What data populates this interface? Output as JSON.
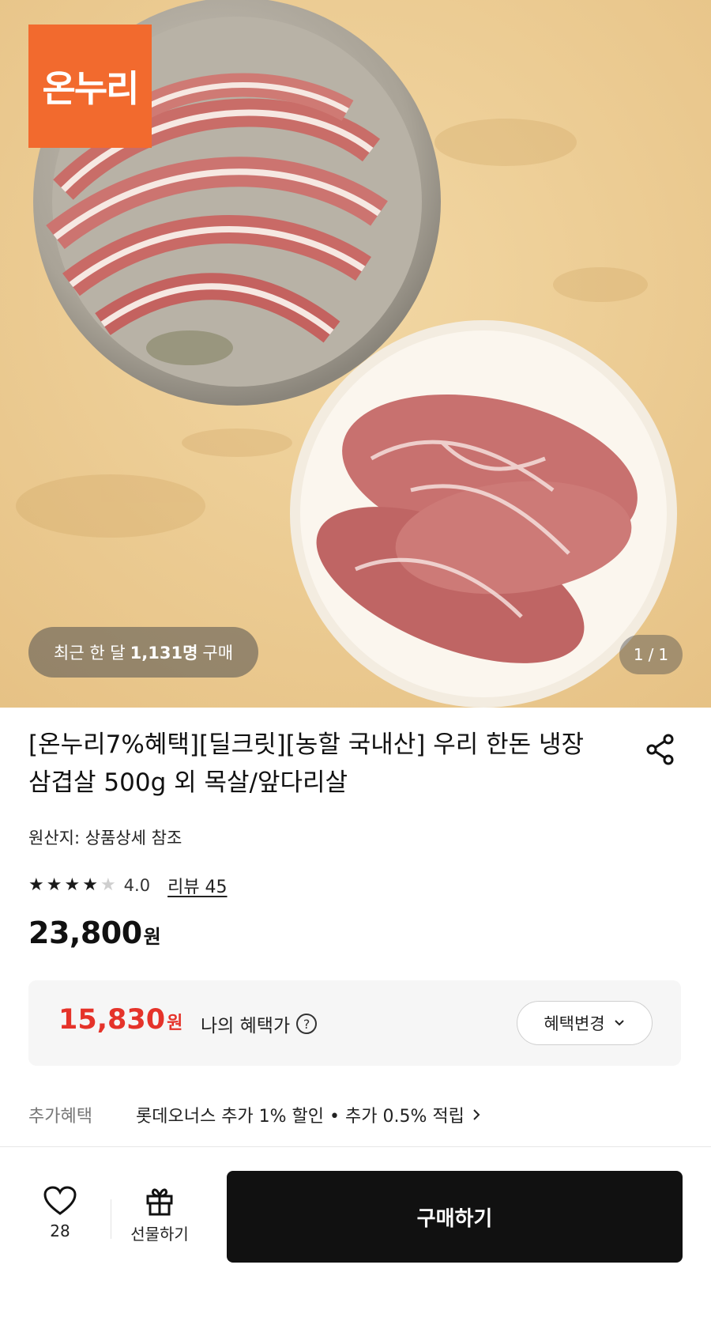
{
  "hero": {
    "logo_text": "온누리",
    "recent_prefix": "최근 한 달",
    "recent_count": "1,131명",
    "recent_suffix": "구매",
    "page_current": "1",
    "page_sep": "/",
    "page_total": "1"
  },
  "product": {
    "title": "[온누리7%혜택][딜크릿][농할 국내산] 우리 한돈 냉장 삼겹살 500g 외 목살/앞다리살",
    "origin": "원산지: 상품상세 참조",
    "rating": {
      "stars_filled": 4,
      "stars_total": 5,
      "score": "4.0",
      "review_link": "리뷰 45"
    },
    "price": {
      "amount": "23,800",
      "unit": "원"
    }
  },
  "benefit": {
    "amount": "15,830",
    "unit": "원",
    "label": "나의 혜택가",
    "help_icon": "?",
    "change_button": "혜택변경"
  },
  "extra": {
    "label": "추가혜택",
    "text": "롯데오너스 추가 1% 할인 • 추가 0.5% 적립"
  },
  "bottom_bar": {
    "like_count": "28",
    "gift_label": "선물하기",
    "buy_label": "구매하기"
  },
  "colors": {
    "brand_orange": "#f26a2e",
    "benefit_red": "#e5332a",
    "buy_black": "#111111"
  },
  "icons": [
    "share-icon",
    "star-icon",
    "help-circle-icon",
    "chevron-down-icon",
    "chevron-right-icon",
    "heart-icon",
    "gift-icon"
  ]
}
